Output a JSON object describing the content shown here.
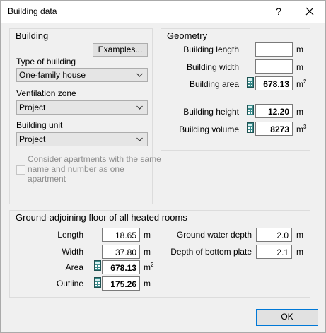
{
  "window": {
    "title": "Building data",
    "help": "?"
  },
  "building": {
    "title": "Building",
    "examples_button": "Examples...",
    "type_label": "Type of building",
    "type_value": "One-family house",
    "ventilation_label": "Ventilation zone",
    "ventilation_value": "Project",
    "unit_label": "Building unit",
    "unit_value": "Project",
    "checkbox_label_1": "Consider apartments with the same",
    "checkbox_label_2": "name and number as one",
    "checkbox_label_3": "apartment",
    "checkbox_checked": false
  },
  "geometry": {
    "title": "Geometry",
    "length_label": "Building length",
    "length_value": "",
    "length_unit": "m",
    "width_label": "Building width",
    "width_value": "",
    "width_unit": "m",
    "area_label": "Building area",
    "area_value": "678.13",
    "area_unit": "m",
    "height_label": "Building height",
    "height_value": "12.20",
    "height_unit": "m",
    "volume_label": "Building volume",
    "volume_value": "8273",
    "volume_unit": "m"
  },
  "ground": {
    "title": "Ground-adjoining floor of all heated rooms",
    "length_label": "Length",
    "length_value": "18.65",
    "length_unit": "m",
    "width_label": "Width",
    "width_value": "37.80",
    "width_unit": "m",
    "area_label": "Area",
    "area_value": "678.13",
    "area_unit": "m",
    "outline_label": "Outline",
    "outline_value": "175.26",
    "outline_unit": "m",
    "gw_label": "Ground water depth",
    "gw_value": "2.0",
    "gw_unit": "m",
    "plate_label": "Depth of bottom plate",
    "plate_value": "2.1",
    "plate_unit": "m"
  },
  "footer": {
    "ok": "OK"
  },
  "icons": {
    "calculator": "calculator-icon",
    "chevron": "chevron-down-icon",
    "close": "close-icon"
  },
  "colors": {
    "accent": "#0078d7",
    "calc_icon": "#3c8c8c"
  }
}
